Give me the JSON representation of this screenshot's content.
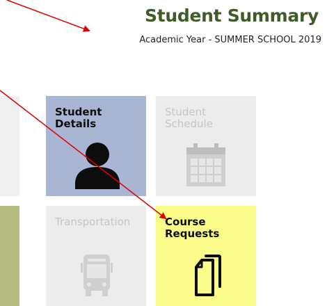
{
  "header": {
    "title": "Student Summary",
    "subtitle": "Academic Year - SUMMER SCHOOL 2019"
  },
  "tiles": [
    {
      "label": "Student\nDetails",
      "icon": "person-icon",
      "state": "active"
    },
    {
      "label": "Student\nSchedule",
      "icon": "calendar-icon",
      "state": "disabled"
    },
    {
      "label": "Transportation",
      "icon": "bus-icon",
      "state": "disabled"
    },
    {
      "label": "Course\nRequests",
      "icon": "documents-icon",
      "state": "active"
    }
  ],
  "colors": {
    "title": "#3f5c28",
    "details_tile": "#a8b6d4",
    "course_tile": "#fbfb8a",
    "disabled_tile": "#ececec",
    "disabled_text": "#c6c6c6",
    "arrow": "#e00000",
    "side_strip_bottom": "#b5bb7e"
  }
}
